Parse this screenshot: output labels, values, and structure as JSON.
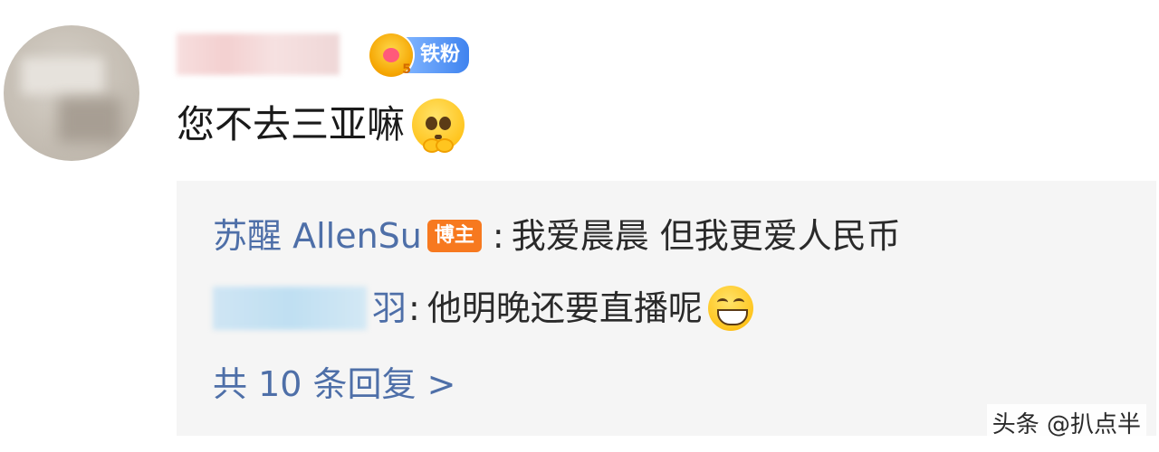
{
  "comment": {
    "badge_label": "铁粉",
    "badge_level": "5",
    "text": "您不去三亚嘛",
    "emoji": "pleading-face-icon"
  },
  "replies": [
    {
      "author": "苏醒 AllenSu",
      "author_badge": "博主",
      "separator": ":",
      "text": "我爱晨晨  但我更爱人民币"
    },
    {
      "author_visible_tail": "羽",
      "separator": ":",
      "text": "他明晚还要直播呢",
      "emoji": "grinning-face-icon"
    }
  ],
  "more_replies_label": "共 10 条回复 >",
  "watermark": "头条 @扒点半",
  "colors": {
    "link_blue": "#4e6fa8",
    "reply_bg": "#f5f5f5",
    "host_badge": "#f7791f"
  }
}
